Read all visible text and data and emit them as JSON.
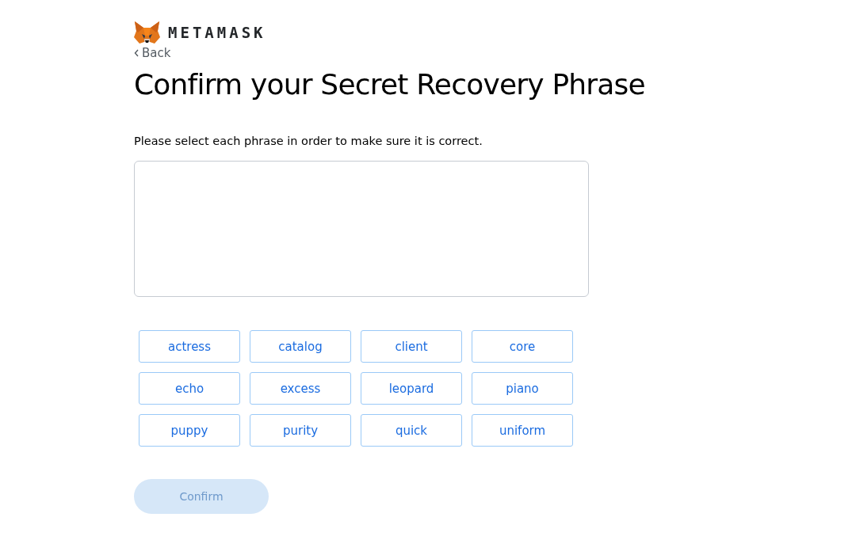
{
  "header": {
    "wordmark": "METAMASK",
    "back": "Back"
  },
  "title": "Confirm your Secret Recovery Phrase",
  "instruction": "Please select each phrase in order to make sure it is correct.",
  "words": [
    "actress",
    "catalog",
    "client",
    "core",
    "echo",
    "excess",
    "leopard",
    "piano",
    "puppy",
    "purity",
    "quick",
    "uniform"
  ],
  "confirm_button": {
    "label": "Confirm",
    "disabled": true
  }
}
